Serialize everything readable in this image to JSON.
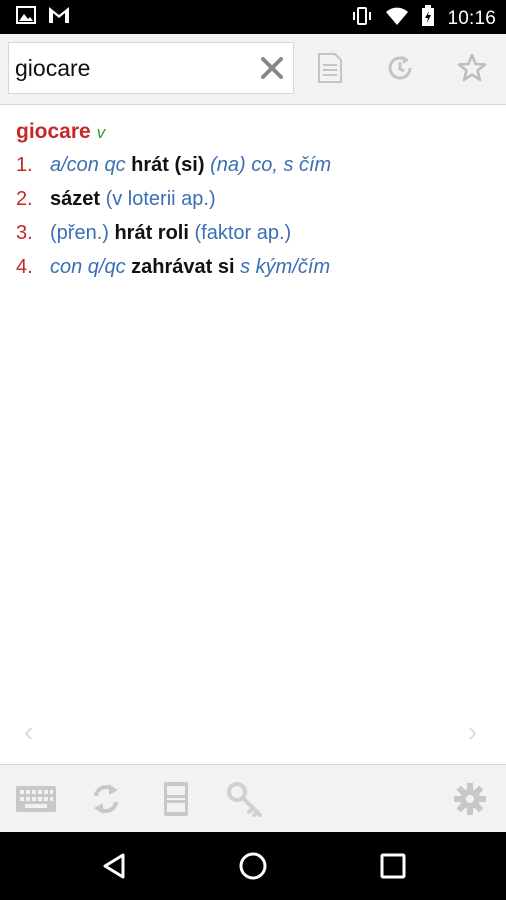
{
  "status_bar": {
    "time": "10:16"
  },
  "search": {
    "value": "giocare"
  },
  "entry": {
    "headword": "giocare",
    "pos": "v",
    "senses": [
      {
        "num": "1.",
        "grammar": "a/con qc",
        "translation": "hrát (si)",
        "context": "(na) co, s čím"
      },
      {
        "num": "2.",
        "translation": "sázet",
        "note": "(v loterii ap.)"
      },
      {
        "num": "3.",
        "note_before": "(přen.)",
        "translation": "hrát roli",
        "note": "(faktor ap.)"
      },
      {
        "num": "4.",
        "grammar": "con q/qc",
        "translation": "zahrávat si",
        "context": "s kým/čím"
      }
    ]
  },
  "pager": {
    "prev": "‹",
    "next": "›"
  },
  "colors": {
    "accent_red": "#c62828",
    "link_blue": "#3b6fb5",
    "pos_green": "#2e9c2e"
  }
}
